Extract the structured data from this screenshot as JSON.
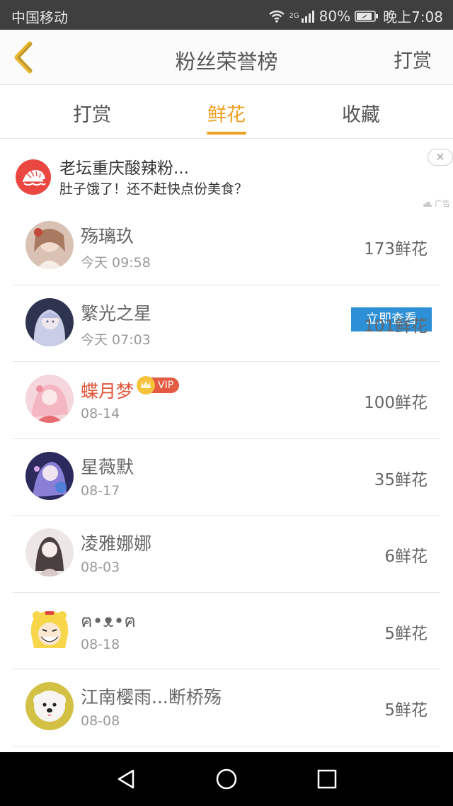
{
  "status_bar": {
    "carrier": "中国移动",
    "network": "2G",
    "battery": "80%",
    "time": "晚上7:08"
  },
  "header": {
    "title": "粉丝荣誉榜",
    "action": "打赏"
  },
  "tabs": [
    {
      "label": "打赏",
      "active": false
    },
    {
      "label": "鲜花",
      "active": true
    },
    {
      "label": "收藏",
      "active": false
    }
  ],
  "accent_color": "#f0a020",
  "ad": {
    "title": "老坛重庆酸辣粉...",
    "subtitle": "肚子饿了！还不赶快点份美食？",
    "button": "立即查看",
    "close": "✕",
    "tag": "广告"
  },
  "fans": [
    {
      "name": "殇璃玖",
      "date": "今天 09:58",
      "flowers": "173鲜花",
      "vip": false
    },
    {
      "name": "繁光之星",
      "date": "今天 07:03",
      "flowers": "101鲜花",
      "vip": false
    },
    {
      "name": "蝶月梦",
      "date": "08-14",
      "flowers": "100鲜花",
      "vip": true,
      "vip_label": "VIP"
    },
    {
      "name": "星薇默",
      "date": "08-17",
      "flowers": "35鲜花",
      "vip": false
    },
    {
      "name": "凌雅娜娜",
      "date": "08-03",
      "flowers": "6鲜花",
      "vip": false
    },
    {
      "name": "ฅ•ᴥ•ฅ",
      "date": "08-18",
      "flowers": "5鲜花",
      "vip": false
    },
    {
      "name": "江南樱雨...断桥殇",
      "date": "08-08",
      "flowers": "5鲜花",
      "vip": false
    }
  ]
}
